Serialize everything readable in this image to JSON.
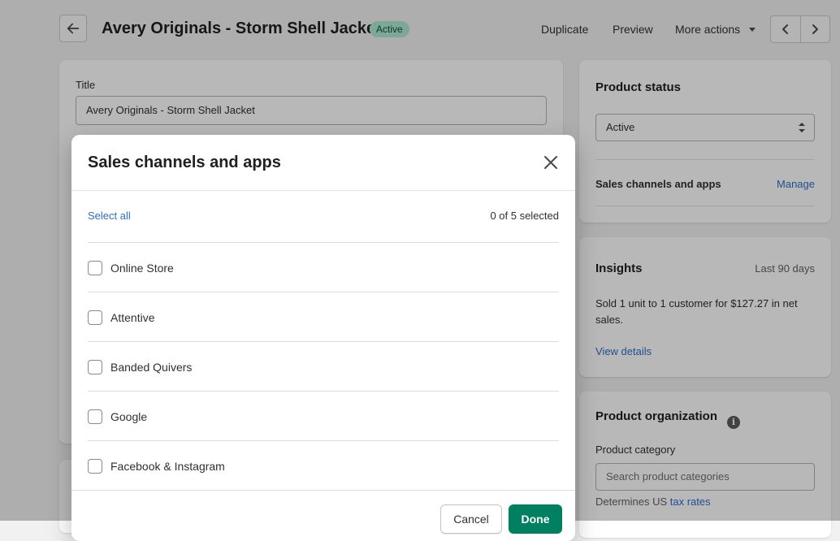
{
  "header": {
    "title": "Avery Originals - Storm Shell Jacket",
    "status_badge": "Active",
    "duplicate_label": "Duplicate",
    "preview_label": "Preview",
    "more_actions_label": "More actions"
  },
  "title_card": {
    "label": "Title",
    "value": "Avery Originals - Storm Shell Jacket"
  },
  "status_card": {
    "heading": "Product status",
    "selected": "Active",
    "sales_channels_label": "Sales channels and apps",
    "manage_label": "Manage"
  },
  "insights_card": {
    "heading": "Insights",
    "period": "Last 90 days",
    "summary": "Sold 1 unit to 1 customer for $127.27 in net sales.",
    "view_details": "View details"
  },
  "organization_card": {
    "heading": "Product organization",
    "category_label": "Product category",
    "category_placeholder": "Search product categories",
    "tax_prefix": "Determines US ",
    "tax_link": "tax rates"
  },
  "modal": {
    "title": "Sales channels and apps",
    "select_all": "Select all",
    "selected_count": "0 of 5 selected",
    "channels": [
      {
        "label": "Online Store",
        "checked": false
      },
      {
        "label": "Attentive",
        "checked": false
      },
      {
        "label": "Banded Quivers",
        "checked": false
      },
      {
        "label": "Google",
        "checked": false
      },
      {
        "label": "Facebook & Instagram",
        "checked": false
      }
    ],
    "cancel_label": "Cancel",
    "done_label": "Done"
  },
  "colors": {
    "primary": "#008060",
    "link": "#2c6ecb",
    "badge_bg": "#aee9d1",
    "badge_text": "#0c5132"
  }
}
